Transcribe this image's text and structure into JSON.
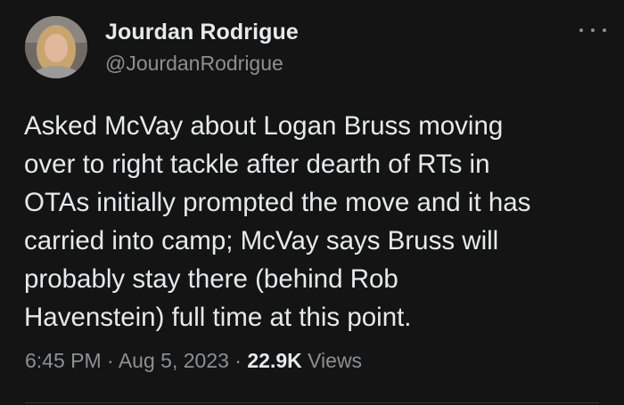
{
  "author": {
    "display_name": "Jourdan Rodrigue",
    "handle": "@JourdanRodrigue"
  },
  "tweet": {
    "text": "Asked McVay about Logan Bruss moving\nover to right tackle after dearth of RTs in\nOTAs initially prompted the move and it has\ncarried into camp; McVay says Bruss will\nprobably stay there (behind Rob\nHavenstein) full time at this point."
  },
  "meta": {
    "time": "6:45 PM",
    "separator1": "·",
    "date": "Aug 5, 2023",
    "separator2": "·",
    "views_count": "22.9K",
    "views_label": "Views"
  },
  "icons": {
    "more": "more-horizontal-icon"
  },
  "colors": {
    "background": "#141414",
    "primary_text": "#e7e9ea",
    "secondary_text": "#8b9095"
  }
}
